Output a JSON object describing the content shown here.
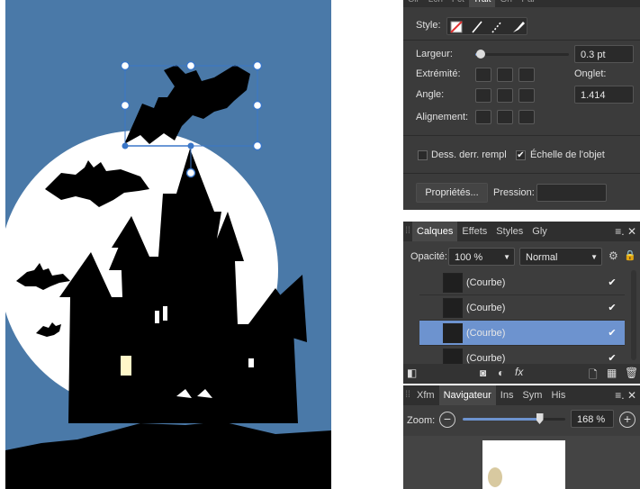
{
  "stroke": {
    "top_tabs": [
      "Clr",
      "Lch",
      "Fct",
      "Trait",
      "Grf",
      "Pal"
    ],
    "style_label": "Style:",
    "width_label": "Largeur:",
    "width_value": "0.3 pt",
    "width_slider_fraction": 0.06,
    "cap_label": "Extrémité:",
    "miter_label": "Onglet:",
    "angle_label": "Angle:",
    "miter_value": "1.414",
    "align_label": "Alignement:",
    "behind_label": "Dess. derr. rempl",
    "behind_checked": false,
    "scale_label": "Échelle de l'objet",
    "scale_checked": true,
    "properties_label": "Propriétés...",
    "pressure_label": "Pression:"
  },
  "layers": {
    "tabs": [
      "Calques",
      "Effets",
      "Styles",
      "Gly"
    ],
    "opacity_label": "Opacité:",
    "opacity_value": "100 %",
    "blend_mode": "Normal",
    "rows": [
      {
        "name": "(Courbe)",
        "checked": true,
        "selected": false
      },
      {
        "name": "(Courbe)",
        "checked": true,
        "selected": false
      },
      {
        "name": "(Courbe)",
        "checked": true,
        "selected": true
      },
      {
        "name": "(Courbe)",
        "checked": true,
        "selected": false
      }
    ]
  },
  "navigator": {
    "tabs": [
      "Xfm",
      "Navigateur",
      "Ins",
      "Sym",
      "His"
    ],
    "zoom_label": "Zoom:",
    "zoom_value": "168 %",
    "zoom_fraction": 0.75
  },
  "colors": {
    "sky": "#4a79a8",
    "moon": "#ffffff",
    "silhouette": "#000000",
    "window": "#fff7c8",
    "selection": "#3a76c8",
    "accent": "#6d93cf"
  }
}
